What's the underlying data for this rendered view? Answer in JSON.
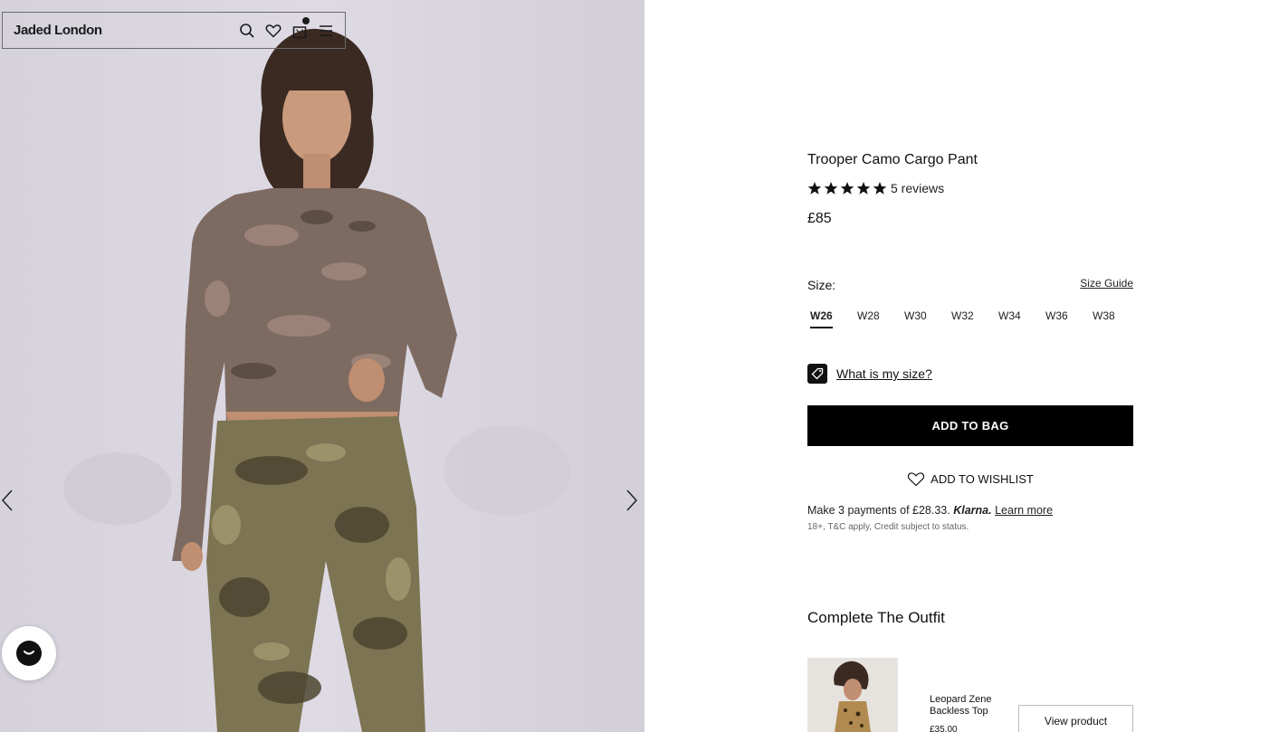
{
  "header": {
    "logo": "Jaded London",
    "icons": [
      "search-icon",
      "heart-icon",
      "bag-icon",
      "menu-icon"
    ]
  },
  "gallery": {
    "prev_icon": "chevron-left-icon",
    "next_icon": "chevron-right-icon"
  },
  "chat": {
    "icon": "chat-icon"
  },
  "product": {
    "title": "Trooper Camo Cargo Pant",
    "rating": 5,
    "reviews": "5 reviews",
    "price": "£85",
    "size_label": "Size:",
    "size_guide": "Size Guide",
    "sizes": [
      "W26",
      "W28",
      "W30",
      "W32",
      "W34",
      "W36",
      "W38"
    ],
    "selected_size": "W26",
    "fit_link": "What is my size?",
    "add_to_bag": "ADD TO BAG",
    "add_to_wishlist": "ADD TO WISHLIST",
    "klarna": {
      "text": "Make 3 payments of £28.33.",
      "brand": "Klarna.",
      "learn_more": "Learn more",
      "note": "18+, T&C apply, Credit subject to status."
    }
  },
  "outfit": {
    "heading": "Complete The Outfit",
    "item": {
      "name": "Leopard Zene Backless Top",
      "price": "£35.00",
      "cta": "View product"
    }
  },
  "colors": {
    "background": "#ffffff",
    "button": "#000000",
    "text": "#111111",
    "hero_bg": "#d9d5e0"
  }
}
